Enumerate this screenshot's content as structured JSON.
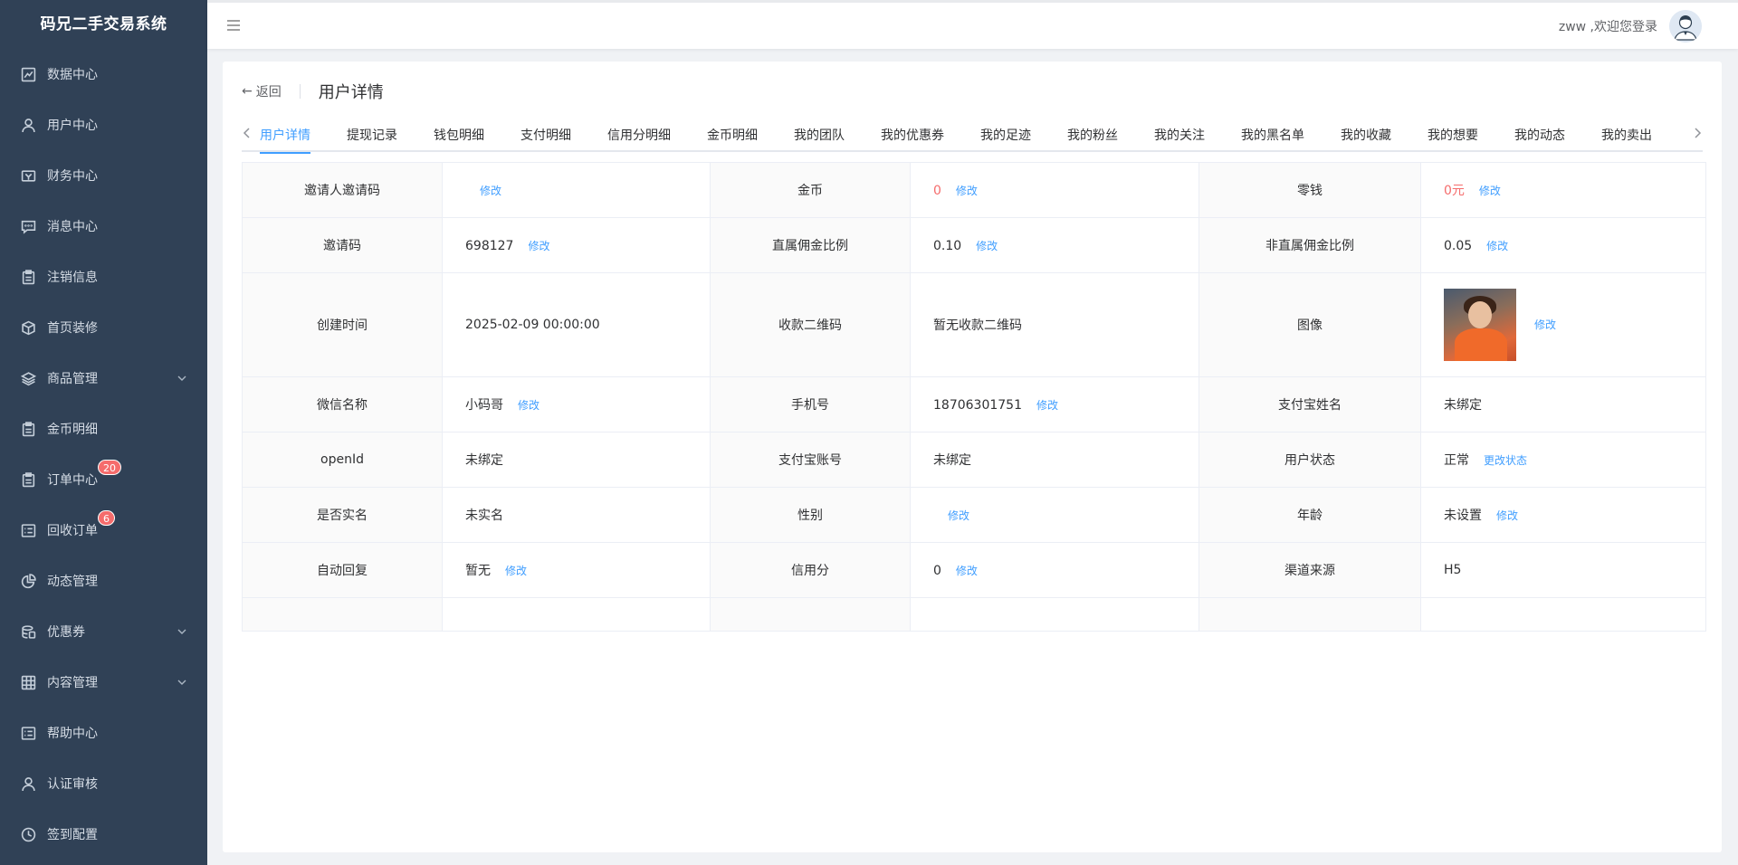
{
  "app": {
    "title": "码兄二手交易系统"
  },
  "sidebar": {
    "items": [
      {
        "label": "数据中心",
        "icon": "chart-icon"
      },
      {
        "label": "用户中心",
        "icon": "user-icon"
      },
      {
        "label": "财务中心",
        "icon": "wallet-icon"
      },
      {
        "label": "消息中心",
        "icon": "message-icon"
      },
      {
        "label": "注销信息",
        "icon": "clipboard-icon"
      },
      {
        "label": "首页装修",
        "icon": "box-icon"
      },
      {
        "label": "商品管理",
        "icon": "layers-icon"
      },
      {
        "label": "金币明细",
        "icon": "clipboard-icon"
      },
      {
        "label": "订单中心",
        "icon": "clipboard-icon",
        "badge": "20"
      },
      {
        "label": "回收订单",
        "icon": "list-icon",
        "badge": "6"
      },
      {
        "label": "动态管理",
        "icon": "pie-icon"
      },
      {
        "label": "优惠券",
        "icon": "coupon-icon"
      },
      {
        "label": "内容管理",
        "icon": "grid-icon"
      },
      {
        "label": "帮助中心",
        "icon": "list-icon"
      },
      {
        "label": "认证审核",
        "icon": "user-icon"
      },
      {
        "label": "签到配置",
        "icon": "clock-icon"
      }
    ]
  },
  "header": {
    "welcome": "zww ,欢迎您登录"
  },
  "page": {
    "back_label": "返回",
    "title": "用户详情"
  },
  "tabs": [
    "用户详情",
    "提现记录",
    "钱包明细",
    "支付明细",
    "信用分明细",
    "金币明细",
    "我的团队",
    "我的优惠券",
    "我的足迹",
    "我的粉丝",
    "我的关注",
    "我的黑名单",
    "我的收藏",
    "我的想要",
    "我的动态",
    "我的卖出"
  ],
  "detail": {
    "edit_label": "修改",
    "change_status_label": "更改状态",
    "rows": [
      {
        "l1": "邀请人邀请码",
        "v1": "",
        "l2": "金币",
        "v2": "0",
        "l3": "零钱",
        "v3": "0元"
      },
      {
        "l1": "邀请码",
        "v1": "698127",
        "l2": "直属佣金比例",
        "v2": "0.10",
        "l3": "非直属佣金比例",
        "v3": "0.05"
      },
      {
        "l1": "创建时间",
        "v1": "2025-02-09 00:00:00",
        "l2": "收款二维码",
        "v2": "暂无收款二维码",
        "l3": "图像",
        "v3": ""
      },
      {
        "l1": "微信名称",
        "v1": "小码哥",
        "l2": "手机号",
        "v2": "18706301751",
        "l3": "支付宝姓名",
        "v3": "未绑定"
      },
      {
        "l1": "openId",
        "v1": "未绑定",
        "l2": "支付宝账号",
        "v2": "未绑定",
        "l3": "用户状态",
        "v3": "正常"
      },
      {
        "l1": "是否实名",
        "v1": "未实名",
        "l2": "性别",
        "v2": "",
        "l3": "年龄",
        "v3": "未设置"
      },
      {
        "l1": "自动回复",
        "v1": "暂无",
        "l2": "信用分",
        "v2": "0",
        "l3": "渠道来源",
        "v3": "H5"
      }
    ]
  },
  "colors": {
    "sidebar_bg": "#304156",
    "accent": "#409eff",
    "danger": "#f56c6c"
  }
}
